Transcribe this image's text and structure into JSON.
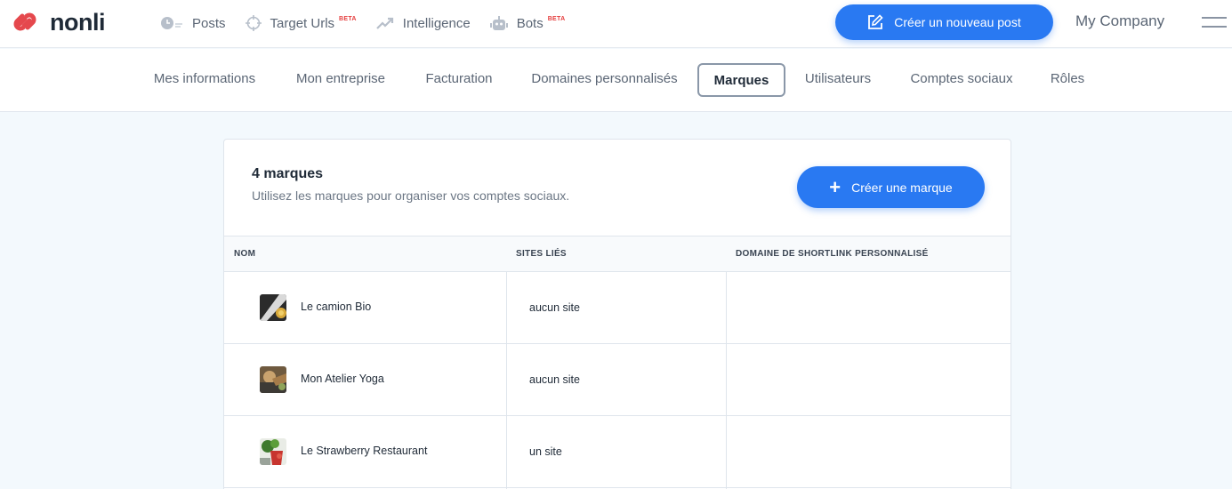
{
  "logo": {
    "text": "nonli"
  },
  "nav": [
    {
      "label": "Posts",
      "icon": "clock-icon",
      "beta": ""
    },
    {
      "label": "Target Urls",
      "icon": "crosshair-icon",
      "beta": "BETA"
    },
    {
      "label": "Intelligence",
      "icon": "trend-up-icon",
      "beta": ""
    },
    {
      "label": "Bots",
      "icon": "robot-icon",
      "beta": "BETA"
    }
  ],
  "header": {
    "new_post_label": "Créer un nouveau post",
    "company_label": "My Company"
  },
  "tabs": [
    {
      "label": "Mes informations",
      "active": false
    },
    {
      "label": "Mon entreprise",
      "active": false
    },
    {
      "label": "Facturation",
      "active": false
    },
    {
      "label": "Domaines personnalisés",
      "active": false
    },
    {
      "label": "Marques",
      "active": true
    },
    {
      "label": "Utilisateurs",
      "active": false
    },
    {
      "label": "Comptes sociaux",
      "active": false
    },
    {
      "label": "Rôles",
      "active": false
    }
  ],
  "brands": {
    "title": "4 marques",
    "subtitle": "Utilisez les marques pour organiser vos comptes sociaux.",
    "create_label": "Créer une marque",
    "columns": [
      "NOM",
      "SITES LIÉS",
      "DOMAINE DE SHORTLINK PERSONNALISÉ"
    ],
    "rows": [
      {
        "name": "Le camion Bio",
        "sites": "aucun site",
        "domain": ""
      },
      {
        "name": "Mon Atelier Yoga",
        "sites": "aucun site",
        "domain": ""
      },
      {
        "name": "Le Strawberry Restaurant",
        "sites": "un site",
        "domain": ""
      }
    ]
  },
  "colors": {
    "accent": "#2979f2",
    "logo_red": "#e5484d",
    "beta_red": "#e53e3e"
  }
}
